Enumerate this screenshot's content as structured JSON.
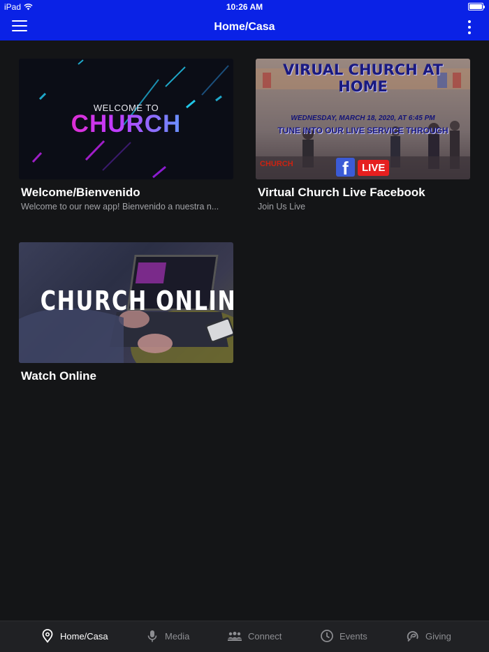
{
  "status_bar": {
    "carrier": "iPad",
    "time": "10:26 AM"
  },
  "header": {
    "title": "Home/Casa",
    "menu_icon": "hamburger-menu-icon",
    "more_icon": "vertical-dots-icon"
  },
  "cards": [
    {
      "title": "Welcome/Bienvenido",
      "subtitle": "Welcome to our new app! Bienvenido a nuestra n...",
      "image": {
        "line1": "WELCOME TO",
        "line2": "CHURCH"
      }
    },
    {
      "title": "Virtual Church Live Facebook",
      "subtitle": "Join Us Live",
      "image": {
        "heading": "VIRUAL CHURCH AT HOME",
        "date": "WEDNESDAY, MARCH 18, 2020, AT 6:45 PM",
        "tune": "TUNE INTO OUR LIVE SERVICE THROUGH",
        "brand": "CHURCH",
        "fb": "f",
        "live": "LIVE"
      }
    },
    {
      "title": "Watch Online",
      "subtitle": "",
      "image": {
        "text": "CHURCH ONLINE"
      }
    }
  ],
  "tabbar": {
    "tabs": [
      {
        "label": "Home/Casa",
        "icon": "location-pin-icon",
        "active": true
      },
      {
        "label": "Media",
        "icon": "microphone-icon",
        "active": false
      },
      {
        "label": "Connect",
        "icon": "people-group-icon",
        "active": false
      },
      {
        "label": "Events",
        "icon": "clock-icon",
        "active": false
      },
      {
        "label": "Giving",
        "icon": "giving-icon",
        "active": false
      }
    ]
  },
  "colors": {
    "header_bg": "#0a22e6",
    "page_bg": "#141517",
    "tabbar_bg": "#202124",
    "inactive_tab": "#8d8e92"
  }
}
